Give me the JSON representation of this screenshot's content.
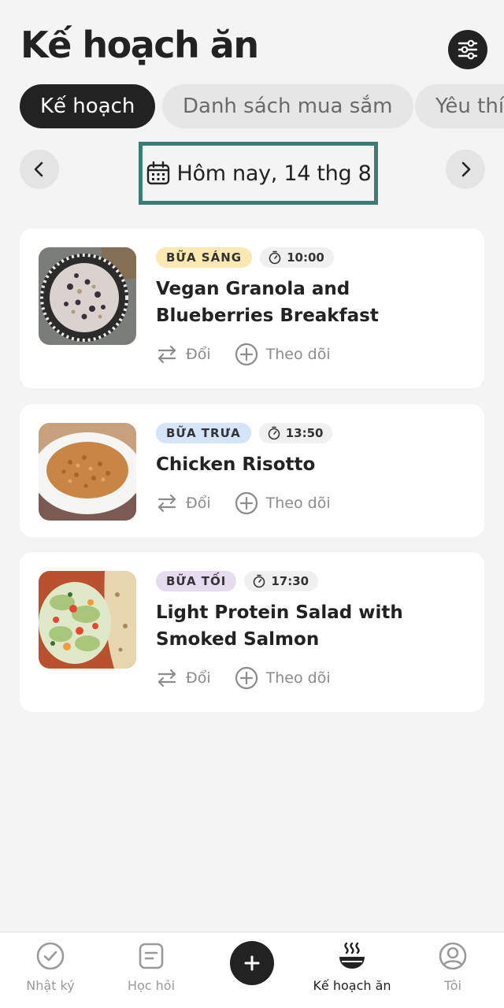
{
  "header": {
    "title": "Kế hoạch ăn"
  },
  "tabs": [
    {
      "label": "Kế hoạch",
      "active": true
    },
    {
      "label": "Danh sách mua sắm",
      "active": false
    },
    {
      "label": "Yêu thích",
      "active": false
    }
  ],
  "date_nav": {
    "label": "Hôm nay, 14 thg 8"
  },
  "meals": [
    {
      "type": "BỮA SÁNG",
      "type_color": "#fbe9b1",
      "time": "10:00",
      "title": "Vegan Granola and Blueberries Breakfast",
      "swap_label": "Đổi",
      "track_label": "Theo dõi"
    },
    {
      "type": "BỮA TRƯA",
      "type_color": "#d4e5fa",
      "time": "13:50",
      "title": "Chicken Risotto",
      "swap_label": "Đổi",
      "track_label": "Theo dõi"
    },
    {
      "type": "BỮA TỐI",
      "type_color": "#e6dcf0",
      "time": "17:30",
      "title": "Light Protein Salad with Smoked Salmon",
      "swap_label": "Đổi",
      "track_label": "Theo dõi"
    }
  ],
  "bottom_nav": [
    {
      "label": "Nhật ký",
      "icon": "check-circle-icon",
      "active": false
    },
    {
      "label": "Học hỏi",
      "icon": "document-icon",
      "active": false
    },
    {
      "label": "",
      "icon": "plus-icon",
      "active": false
    },
    {
      "label": "Kế hoạch ăn",
      "icon": "steaming-bowl-icon",
      "active": true
    },
    {
      "label": "Tôi",
      "icon": "profile-icon",
      "active": false
    }
  ],
  "colors": {
    "background": "#f4f4f4",
    "primary_dark": "#222222",
    "highlight_border": "#3a7d74",
    "muted_text": "#8c8c8c"
  }
}
